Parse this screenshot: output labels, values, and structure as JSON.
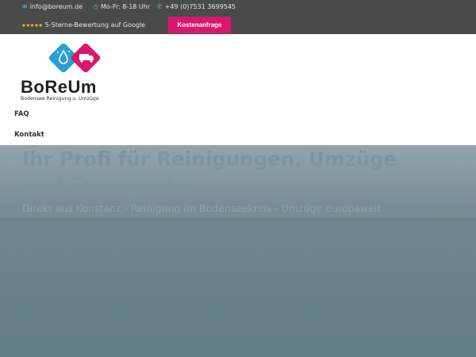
{
  "topbar": {
    "email": "info@boreum.de",
    "hours": "Mo-Fr: 8-18 Uhr",
    "phone": "+49 (0)7531 3699545",
    "rating_stars": "★★★★★",
    "rating_text": "5-Sterne-Bewertung auf Google",
    "cta_label": "Kostenanfrage"
  },
  "icons": {
    "email": "envelope-icon",
    "hours": "clock-icon",
    "phone": "phone-icon"
  },
  "logo": {
    "name": "BoReUm",
    "tagline": "Bodensee Reinigung u. Umzüge"
  },
  "nav": {
    "items": [
      {
        "label": "FAQ"
      },
      {
        "label": "Kontakt"
      }
    ]
  },
  "hero": {
    "title": "Ihr Profi für Reinigungen, Umzüge und Transporte",
    "subtitle": "Direkt aus Konstanz - Reinigung im Bodenseekreis - Umzüge europaweit"
  },
  "colors": {
    "accent_pink": "#d8186e",
    "accent_blue": "#2a9fd6",
    "topbar_bg": "#4a4a4a"
  }
}
